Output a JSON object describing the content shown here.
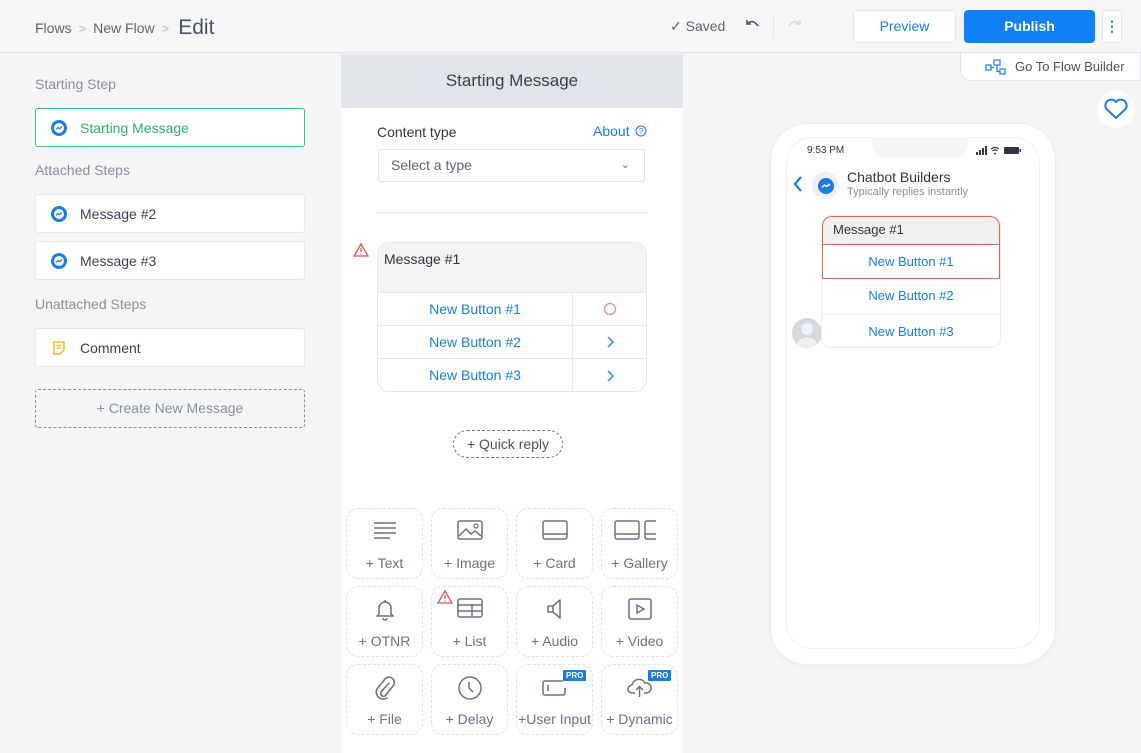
{
  "header": {
    "breadcrumbs": [
      "Flows",
      "New Flow"
    ],
    "current": "Edit",
    "saved_label": "Saved",
    "preview_label": "Preview",
    "publish_label": "Publish",
    "more_label": "⋮",
    "flow_builder_label": "Go To Flow Builder"
  },
  "sidebar": {
    "starting_label": "Starting Step",
    "starting_step": "Starting Message",
    "attached_label": "Attached Steps",
    "attached_steps": [
      "Message #2",
      "Message #3"
    ],
    "unattached_label": "Unattached Steps",
    "unattached_steps": [
      "Comment"
    ],
    "create_label": "+ Create New Message"
  },
  "editor": {
    "title": "Starting Message",
    "content_type_label": "Content type",
    "about_label": "About",
    "select_placeholder": "Select a type",
    "message_title": "Message #1",
    "buttons": [
      "New Button #1",
      "New Button #2",
      "New Button #3"
    ],
    "quick_reply_label": "+ Quick reply",
    "tiles": [
      {
        "label": "+ Text",
        "icon": "text-icon"
      },
      {
        "label": "+ Image",
        "icon": "image-icon"
      },
      {
        "label": "+ Card",
        "icon": "card-icon"
      },
      {
        "label": "+ Gallery",
        "icon": "gallery-icon"
      },
      {
        "label": "+ OTNR",
        "icon": "bell-icon"
      },
      {
        "label": "+ List",
        "icon": "list-icon",
        "warning": true
      },
      {
        "label": "+ Audio",
        "icon": "speaker-icon"
      },
      {
        "label": "+ Video",
        "icon": "video-icon"
      },
      {
        "label": "+ File",
        "icon": "paperclip-icon"
      },
      {
        "label": "+ Delay",
        "icon": "clock-icon"
      },
      {
        "label": "+User Input",
        "icon": "input-icon",
        "badge": "PRO"
      },
      {
        "label": "+ Dynamic",
        "icon": "cloud-upload-icon",
        "badge": "PRO"
      }
    ]
  },
  "preview": {
    "time": "9:53 PM",
    "bot_name": "Chatbot Builders",
    "bot_subtitle": "Typically replies instantly",
    "message_title": "Message #1",
    "buttons": [
      "New Button #1",
      "New Button #2",
      "New Button #3"
    ]
  },
  "colors": {
    "accent": "#0f80f5",
    "link": "#1a7ee0",
    "active_step": "#27b56a",
    "error": "#d9684e",
    "pro_badge": "#1a7ee0"
  }
}
